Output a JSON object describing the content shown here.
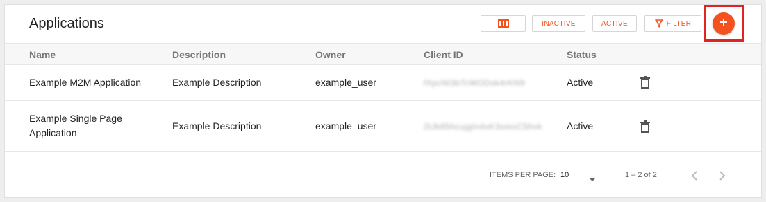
{
  "page": {
    "title": "Applications"
  },
  "toolbar": {
    "columns_icon": "columns-icon",
    "inactive_label": "INACTIVE",
    "active_label": "ACTIVE",
    "filter_label": "FILTER",
    "filter_icon": "filter-icon",
    "add_icon": "plus-icon",
    "accent_color": "#f4511e",
    "highlight_color": "#e02424"
  },
  "table": {
    "headers": [
      "Name",
      "Description",
      "Owner",
      "Client ID",
      "Status"
    ],
    "rows": [
      {
        "name": "Example M2M Application",
        "description": "Example Description",
        "owner": "example_user",
        "client_id": "fXpcNl3bTcWODsk4rKN9",
        "status": "Active",
        "action_icon": "trash-icon"
      },
      {
        "name": "Example Single Page Application",
        "description": "Example Description",
        "owner": "example_user",
        "client_id": "2tJk85hcujgIn4xK3smoC5hvk",
        "status": "Active",
        "action_icon": "trash-icon"
      }
    ]
  },
  "pagination": {
    "items_per_page_label": "ITEMS PER PAGE:",
    "items_per_page_value": "10",
    "range_label": "1 – 2 of 2",
    "prev_icon": "chevron-left-icon",
    "next_icon": "chevron-right-icon"
  }
}
